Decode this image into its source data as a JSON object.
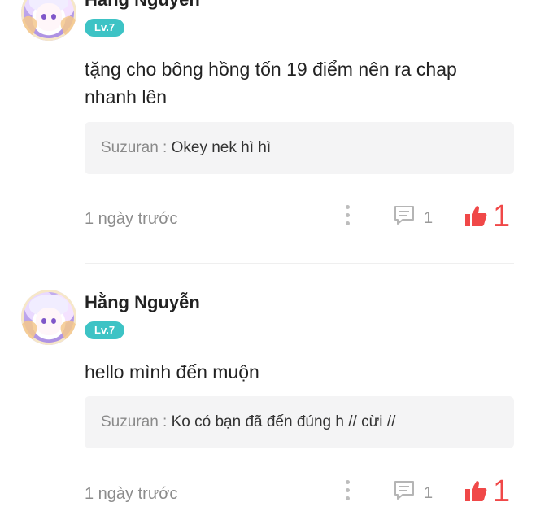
{
  "colors": {
    "accent_like": "#f04848",
    "level_badge": "#3dc3c5"
  },
  "comments": [
    {
      "username": "Hằng Nguyễn",
      "level": "Lv.7",
      "text": "tặng cho bông hồng tốn 19 điểm nên ra chap nhanh lên",
      "reply": {
        "author": "Suzuran : ",
        "message": "Okey nek hì hì"
      },
      "time": "1 ngày trước",
      "reply_count": "1",
      "like_count": "1"
    },
    {
      "username": "Hằng Nguyễn",
      "level": "Lv.7",
      "text": "hello mình đến muộn",
      "reply": {
        "author": "Suzuran : ",
        "message": "Ko có bạn đã đến đúng h // cừi //"
      },
      "time": "1 ngày trước",
      "reply_count": "1",
      "like_count": "1"
    }
  ]
}
